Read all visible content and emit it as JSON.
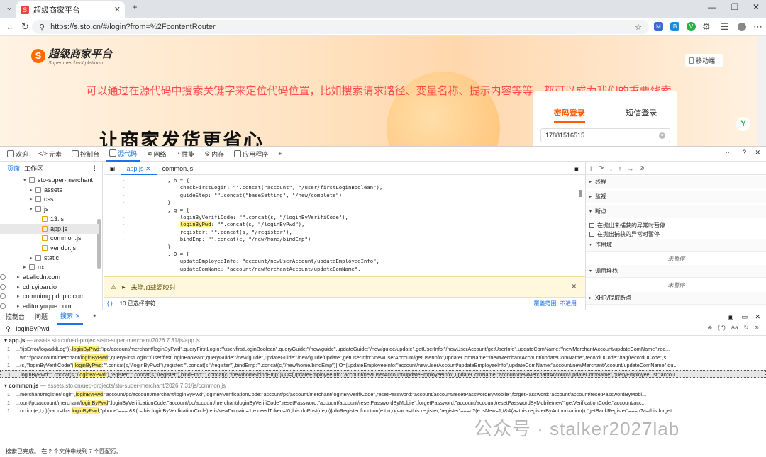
{
  "browser": {
    "tab_title": "超级商家平台",
    "tab_favicon": "S",
    "url": "https://s.sto.cn/#/login?from=%2FcontentRouter",
    "extensions": [
      "M",
      "B",
      "V"
    ]
  },
  "page": {
    "logo_title": "超级商家平台",
    "logo_sub": "Super merchant platform",
    "mobile_label": "移动端",
    "overlay_text": "可以通过在源代码中搜索关键字来定位代码位置，比如搜索请求路径、变量名称、提示内容等等，都可以成为我们的重要线索",
    "slogan": "让商家发货更省心",
    "login": {
      "tab_password": "密码登录",
      "tab_sms": "短信登录",
      "phone_value": "17881516515"
    },
    "accent_color": "#ff5a00"
  },
  "devtools": {
    "tabs": [
      "欢迎",
      "元素",
      "控制台",
      "源代码",
      "网络",
      "性能",
      "内存",
      "应用程序"
    ],
    "active_tab": "源代码",
    "nav_tabs": [
      "页面",
      "工作区"
    ],
    "tree": [
      {
        "label": "sto-super-merchant",
        "indent": 1,
        "type": "folder",
        "arrow": "▾"
      },
      {
        "label": "assets",
        "indent": 2,
        "type": "folder",
        "arrow": "▸"
      },
      {
        "label": "css",
        "indent": 2,
        "type": "folder",
        "arrow": "▸"
      },
      {
        "label": "js",
        "indent": 2,
        "type": "folder",
        "arrow": "▾"
      },
      {
        "label": "13.js",
        "indent": 3,
        "type": "js",
        "arrow": ""
      },
      {
        "label": "app.js",
        "indent": 3,
        "type": "js",
        "arrow": "",
        "selected": true
      },
      {
        "label": "common.js",
        "indent": 3,
        "type": "js",
        "arrow": ""
      },
      {
        "label": "vendor.js",
        "indent": 3,
        "type": "js",
        "arrow": ""
      },
      {
        "label": "static",
        "indent": 2,
        "type": "folder",
        "arrow": "▸"
      },
      {
        "label": "ux",
        "indent": 1,
        "type": "folder",
        "arrow": "▸"
      },
      {
        "label": "at.alicdn.com",
        "indent": 0,
        "type": "cloud",
        "arrow": "▸"
      },
      {
        "label": "cdn.yiban.io",
        "indent": 0,
        "type": "cloud",
        "arrow": "▸"
      },
      {
        "label": "commimg.pddpic.com",
        "indent": 0,
        "type": "cloud",
        "arrow": "▸"
      },
      {
        "label": "editor.yuque.com",
        "indent": 0,
        "type": "cloud",
        "arrow": "▸"
      }
    ],
    "editor_tabs": [
      "app.js",
      "common.js"
    ],
    "code_lines": [
      {
        "pre": "        , h = {",
        "hl": "",
        "post": "",
        "hltype": ""
      },
      {
        "pre": "            checkFirstLogin: \"\".concat(\"account\", \"/user/firstLoginBoolean\"),",
        "hl": "",
        "post": "",
        "hltype": ""
      },
      {
        "pre": "            guideStep: \"\".concat(\"baseSetting\", \"/new/complete\")",
        "hl": "",
        "post": "",
        "hltype": ""
      },
      {
        "pre": "        }",
        "hl": "",
        "post": "",
        "hltype": ""
      },
      {
        "pre": "        , g = {",
        "hl": "",
        "post": "",
        "hltype": ""
      },
      {
        "pre": "            loginByVerifiCode: \"\".concat(s, \"/loginByVerifiCode\"),",
        "hl": "",
        "post": "",
        "hltype": ""
      },
      {
        "pre": "            ",
        "hl": "loginByPwd",
        "post": ": \"\".concat(s, \"/loginByPwd\"),",
        "hltype": "y"
      },
      {
        "pre": "            register: \"\".concat(s, \"/register\"),",
        "hl": "",
        "post": "",
        "hltype": ""
      },
      {
        "pre": "            bindEmp: \"\".concat(c, \"/new/home/bindEmp\")",
        "hl": "",
        "post": "",
        "hltype": ""
      },
      {
        "pre": "        }",
        "hl": "",
        "post": "",
        "hltype": ""
      },
      {
        "pre": "        , O = {",
        "hl": "",
        "post": "",
        "hltype": ""
      },
      {
        "pre": "            updateEmployeeInfo: \"account/newUserAccount/updateEmployeeInfo\",",
        "hl": "",
        "post": "",
        "hltype": ""
      },
      {
        "pre": "            updateComName: \"account/newMerchantAccount/updateComName\",",
        "hl": "",
        "post": "",
        "hltype": ""
      }
    ],
    "warning": "未能加载源映射",
    "selection_status": "10 已选择字符",
    "coverage": "覆盖范围: 不适用",
    "debugger": {
      "sections": [
        "线程",
        "监视",
        "断点",
        "作用域",
        "调用堆栈",
        "XHR/提取断点"
      ],
      "checkbox_uncaught": "在抛出未捕获的异常时暂停",
      "checkbox_caught": "在抛出捕获的异常时暂停",
      "not_paused": "未暂停"
    },
    "drawer_tabs": [
      "控制台",
      "问题",
      "搜索"
    ],
    "active_drawer": "搜索",
    "search_query": "loginByPwd",
    "search_options": [
      "(.*)",
      "Aa"
    ],
    "results": [
      {
        "file": "app.js",
        "path": "assets.sto.cn/ued-projects/sto-super-merchant/2026.7.31/js/app.js",
        "lines": [
          {
            "n": "1",
            "pre": "...\"/jsError/log/addLog\")},",
            "hl": "loginByPwd",
            "post": ":\"/pc/account/merchant/loginByPwd\",queryFirstLogin:\"/user/firstLoginBoolean\",queryGuide:\"/new/guide\",updateGuide:\"/new/guide/update\",getUserInfo:\"/newUserAccount/getUserInfo\",updateComName:\"/newMerchantAccount/updateComName\",rec...",
            "sel": false
          },
          {
            "n": "1",
            "pre": "...wd:\"/pc/account/merchant/",
            "hl": "loginByPwd",
            "post": "\",queryFirstLogin:\"/user/firstLoginBoolean\",queryGuide:\"/new/guide\",updateGuide:\"/new/guide/update\",getUserInfo:\"/newUserAccount/getUserInfo\",updateComName:\"/newMerchantAccount/updateComName\",recordUCode:\"/tag/recordUCode\",s...",
            "sel": false
          },
          {
            "n": "1",
            "pre": "...(s,\"/loginByVerifiCode\"),",
            "hl": "loginByPwd",
            "post": ":\"\".concat(s,\"/loginByPwd\"),register:\"\".concat(s,\"/register\"),bindEmp:\"\".concat(c,\"/new/home/bindEmp\")},O={updateEmployeeInfo:\"account/newUserAccount/updateEmployeeInfo\",updateComName:\"account/newMerchantAccount/updateComName\",qu...",
            "sel": false
          },
          {
            "n": "1",
            "pre": "...loginByPwd:\"\".concat(s,\"/",
            "hl": "loginByPwd",
            "post": "\"),register:\"\".concat(s,\"/register\"),bindEmp:\"\".concat(c,\"/new/home/bindEmp\")},O={updateEmployeeInfo:\"account/newUserAccount/updateEmployeeInfo\",updateComName:\"account/newMerchantAccount/updateComName\",queryEmployeeList:\"accou...",
            "sel": true
          }
        ]
      },
      {
        "file": "common.js",
        "path": "assets.sto.cn/ued-projects/sto-super-merchant/2026.7.31/js/common.js",
        "lines": [
          {
            "n": "1",
            "pre": "...merchant/register/login\",",
            "hl": "loginByPwd",
            "post": ":\"account/pc/account/merchant/loginByPwd\",loginByVerificationCode:\"account/pc/account/merchant/loginByVerifiCode\",resetPassword:\"account/account/resetPasswordByMobile\",forgetPassword:\"account/account/resetPasswordByMobi...",
            "sel": false
          },
          {
            "n": "1",
            "pre": "...ount/pc/account/merchant/",
            "hl": "loginByPwd",
            "post": "\",loginByVerificationCode:\"account/pc/account/merchant/loginByVerifiCode\",resetPassword:\"account/account/resetPasswordByMobile\",forgetPassword:\"account/account/resetPasswordByMobile/new\",getVerificationCode:\"account/acc...",
            "sel": false
          },
          {
            "n": "1",
            "pre": "...nction(e,t,n){var r=this.",
            "hl": "loginByPwd",
            "post": ";\"phone\"===t&&(r=this.loginByVerificationCode),e.isNewDomain=1,e.needToken=!0,this.doPost(r,e,n)},doRegister:function(e,t,n,r){var a=this.register;\"register\"===n?(e.isNew=1,t&&(a=this.registerByAuthorization)):\"getBackRegister\"===n?a=this.forget...",
            "sel": false
          }
        ]
      }
    ],
    "status": "搜索已完成。  在 2 个文件中找到 7 个匹配行。"
  },
  "watermark": "公众号 · stalker2027lab"
}
